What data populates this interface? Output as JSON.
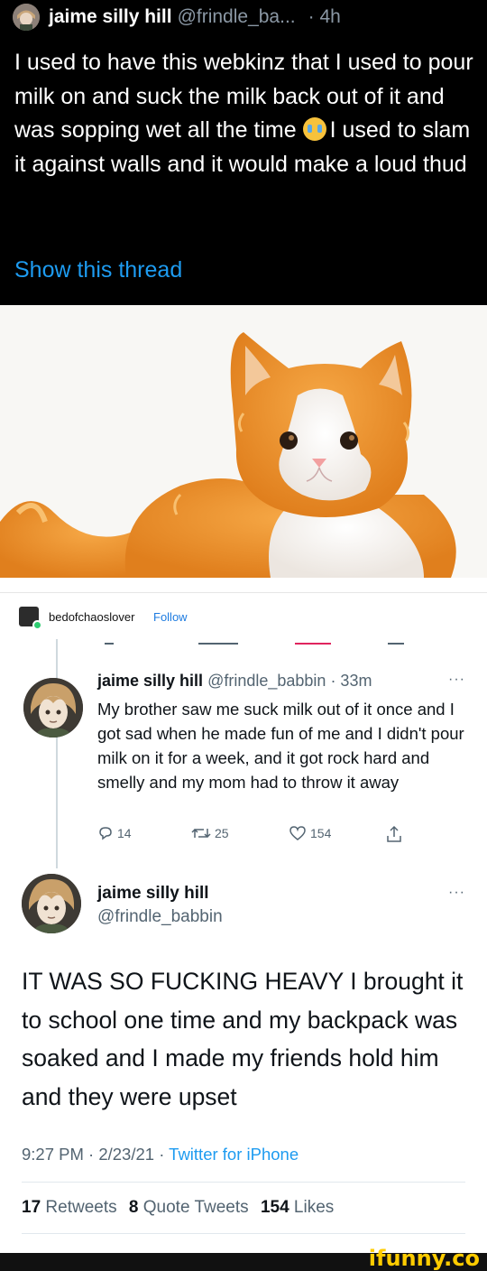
{
  "top_tweet": {
    "display_name": "jaime silly hill",
    "handle": "@frindle_ba...",
    "time": "· 4h",
    "text_before_emoji": "I used to have this webkinz that I used to pour milk on and suck the milk back out of it and was sopping wet all the time ",
    "emoji": "loudly-crying-face",
    "text_after_emoji": "I used to slam it against walls and it would make a loud thud",
    "show_thread": "Show this thread"
  },
  "photo": {
    "subject": "orange-and-white-plush-cat"
  },
  "tumblr": {
    "username": "bedofchaoslover",
    "follow": "Follow"
  },
  "reply_tweet": {
    "display_name": "jaime silly hill",
    "handle_time": "@frindle_babbin · 33m",
    "more": "···",
    "text": "My brother saw me suck milk out of it once and I got sad when he made fun of me and I didn't pour milk on it for a week, and it got rock hard and smelly and my mom had to throw it away",
    "replies": "14",
    "retweets": "25",
    "likes": "154"
  },
  "main_tweet": {
    "display_name": "jaime silly hill",
    "handle": "@frindle_babbin",
    "more": "···",
    "text": "IT WAS SO FUCKING HEAVY I brought it to school one time and my backpack was soaked and I made my friends hold him and they were upset",
    "time_date": "9:27 PM · 2/23/21 · ",
    "source": "Twitter for iPhone",
    "retweets_count": "17",
    "retweets_label": "Retweets",
    "quotes_count": "8",
    "quotes_label": "Quote Tweets",
    "likes_count": "154",
    "likes_label": "Likes"
  },
  "watermark": "ifunny.co",
  "colors": {
    "dark_bg": "#000000",
    "twitter_blue": "#1d9bf0",
    "secondary_text": "#536471",
    "ifunny_yellow": "#ffcc00"
  }
}
